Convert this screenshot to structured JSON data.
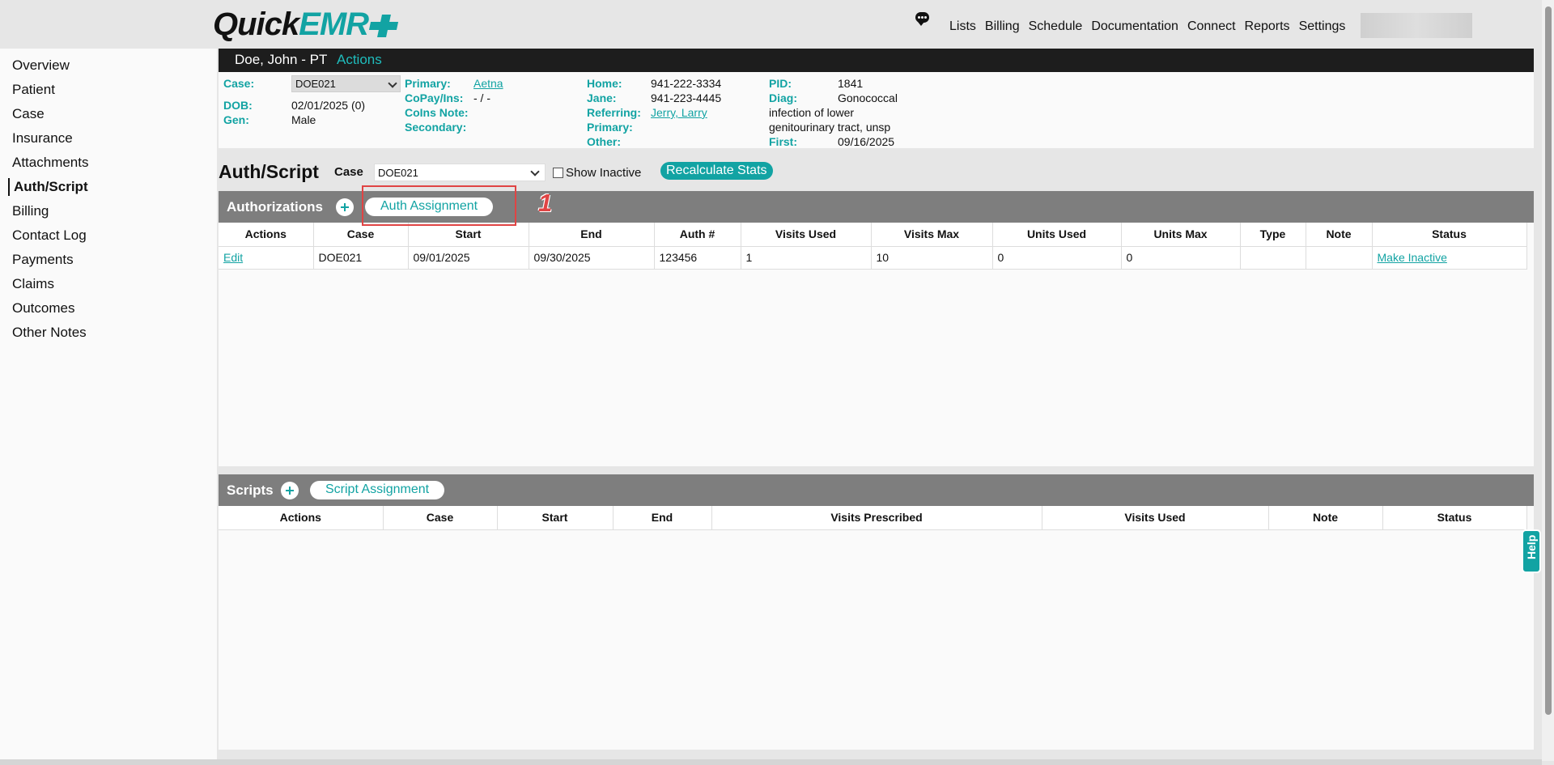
{
  "app": {
    "logo_quick": "Quick",
    "logo_emr": "EMR",
    "nav": [
      "Lists",
      "Billing",
      "Schedule",
      "Documentation",
      "Connect",
      "Reports",
      "Settings"
    ]
  },
  "sidebar": {
    "items": [
      {
        "label": "Overview"
      },
      {
        "label": "Patient"
      },
      {
        "label": "Case"
      },
      {
        "label": "Insurance"
      },
      {
        "label": "Attachments"
      },
      {
        "label": "Auth/Script"
      },
      {
        "label": "Billing"
      },
      {
        "label": "Contact Log"
      },
      {
        "label": "Payments"
      },
      {
        "label": "Claims"
      },
      {
        "label": "Outcomes"
      },
      {
        "label": "Other Notes"
      }
    ],
    "active": "Auth/Script"
  },
  "patient": {
    "name": "Doe, John - PT",
    "actions_label": "Actions",
    "case_label": "Case:",
    "case_value": "DOE021",
    "dob_label": "DOB:",
    "dob_value": "02/01/2025 (0)",
    "gen_label": "Gen:",
    "gen_value": "Male",
    "primary_label": "Primary:",
    "primary_value": "Aetna",
    "copay_label": "CoPay/Ins:",
    "copay_value": "- / -",
    "coins_label": "CoIns Note:",
    "secondary_label": "Secondary:",
    "home_label": "Home:",
    "home_value": "941-222-3334",
    "jane_label": "Jane:",
    "jane_value": "941-223-4445",
    "referring_label": "Referring:",
    "referring_value": "Jerry, Larry",
    "primary2_label": "Primary:",
    "other_label": "Other:",
    "pid_label": "PID:",
    "pid_value": "1841",
    "diag_label": "Diag:",
    "diag_value_1": "Gonococcal",
    "diag_value_2": "infection of lower",
    "diag_value_3": "genitourinary tract, unsp",
    "first_label": "First:",
    "first_value": "09/16/2025"
  },
  "auth_script": {
    "title": "Auth/Script",
    "case_label": "Case",
    "case_selected": "DOE021",
    "show_inactive_label": "Show Inactive",
    "recalc_label": "Recalculate Stats"
  },
  "authorizations": {
    "title": "Authorizations",
    "assign_label": "Auth Assignment",
    "step_number": "1",
    "columns": [
      "Actions",
      "Case",
      "Start",
      "End",
      "Auth #",
      "Visits Used",
      "Visits Max",
      "Units Used",
      "Units Max",
      "Type",
      "Note",
      "Status"
    ],
    "rows": [
      {
        "action": "Edit",
        "case": "DOE021",
        "start": "09/01/2025",
        "end": "09/30/2025",
        "auth": "123456",
        "visits_used": "1",
        "visits_max": "10",
        "units_used": "0",
        "units_max": "0",
        "type": "",
        "note": "",
        "status": "Make Inactive"
      }
    ]
  },
  "scripts": {
    "title": "Scripts",
    "assign_label": "Script Assignment",
    "columns": [
      "Actions",
      "Case",
      "Start",
      "End",
      "Visits Prescribed",
      "Visits Used",
      "Note",
      "Status"
    ]
  },
  "help_label": "Help",
  "colors": {
    "accent": "#12a3a3",
    "header_dark": "#1d1d1d",
    "panel_head": "#7e7e7e",
    "highlight": "#e04444"
  }
}
